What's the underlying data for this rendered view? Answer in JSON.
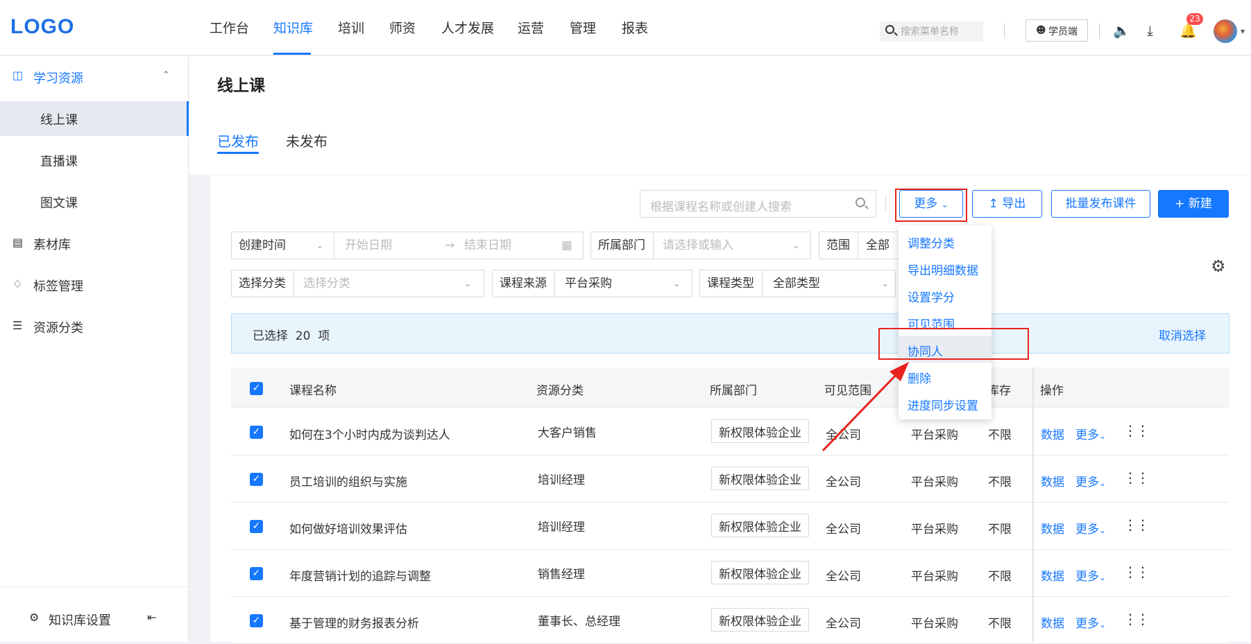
{
  "header": {
    "logo": "LOGO",
    "nav": [
      "工作台",
      "知识库",
      "培训",
      "师资",
      "人才发展",
      "运营",
      "管理",
      "报表"
    ],
    "active_nav": "知识库",
    "search_placeholder": "搜索菜单名称",
    "student_label": "学员端",
    "notification_count": "23"
  },
  "sidebar": {
    "group_label": "学习资源",
    "items": [
      "线上课",
      "直播课",
      "图文课"
    ],
    "active_item": "线上课",
    "sections": [
      "素材库",
      "标签管理",
      "资源分类"
    ],
    "footer_label": "知识库设置"
  },
  "page": {
    "title": "线上课",
    "tabs": [
      "已发布",
      "未发布"
    ],
    "active_tab": "已发布"
  },
  "toolbar": {
    "search_placeholder": "根据课程名称或创建人搜索",
    "more_label": "更多",
    "export_label": "导出",
    "batch_publish_label": "批量发布课件",
    "new_label": "新建"
  },
  "filters": {
    "created_time_label": "创建时间",
    "start_date_placeholder": "开始日期",
    "arrow": "→",
    "end_date_placeholder": "结束日期",
    "dept_label": "所属部门",
    "dept_placeholder": "请选择或输入",
    "scope_label": "范围",
    "scope_value": "全部",
    "category_label": "选择分类",
    "category_placeholder": "选择分类",
    "source_label": "课程来源",
    "source_value": "平台采购",
    "type_label": "课程类型",
    "type_value": "全部类型"
  },
  "selection": {
    "text": "已选择  20  项",
    "cancel_label": "取消选择"
  },
  "dropdown": {
    "items": [
      "调整分类",
      "导出明细数据",
      "设置学分",
      "可见范围",
      "协同人",
      "删除",
      "进度同步设置"
    ],
    "highlighted": "协同人"
  },
  "table": {
    "headers": {
      "name": "课程名称",
      "category": "资源分类",
      "dept": "所属部门",
      "scope": "可见范围",
      "stock": "库存",
      "ops": "操作"
    },
    "rows": [
      {
        "name": "如何在3个小时内成为谈判达人",
        "category": "大客户销售",
        "dept": "新权限体验企业",
        "scope": "全公司",
        "source": "平台采购",
        "stock": "不限"
      },
      {
        "name": "员工培训的组织与实施",
        "category": "培训经理",
        "dept": "新权限体验企业",
        "scope": "全公司",
        "source": "平台采购",
        "stock": "不限"
      },
      {
        "name": "如何做好培训效果评估",
        "category": "培训经理",
        "dept": "新权限体验企业",
        "scope": "全公司",
        "source": "平台采购",
        "stock": "不限"
      },
      {
        "name": "年度营销计划的追踪与调整",
        "category": "销售经理",
        "dept": "新权限体验企业",
        "scope": "全公司",
        "source": "平台采购",
        "stock": "不限"
      },
      {
        "name": "基于管理的财务报表分析",
        "category": "董事长、总经理",
        "dept": "新权限体验企业",
        "scope": "全公司",
        "source": "平台采购",
        "stock": "不限"
      }
    ],
    "op_data": "数据",
    "op_more": "更多"
  }
}
